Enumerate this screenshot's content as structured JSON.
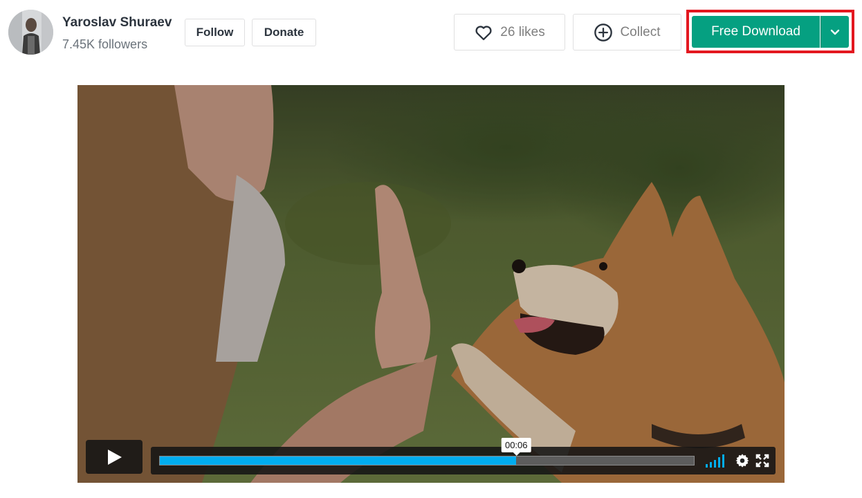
{
  "author": {
    "name": "Yaroslav Shuraev",
    "followers": "7.45K followers"
  },
  "actions": {
    "follow_label": "Follow",
    "donate_label": "Donate",
    "likes_label": "26 likes",
    "collect_label": "Collect",
    "download_label": "Free Download"
  },
  "icons": {
    "like": "heart-icon",
    "collect": "plus-circle-icon",
    "download_toggle": "chevron-down-icon",
    "play": "play-icon",
    "volume": "volume-icon",
    "settings": "gear-icon",
    "fullscreen": "fullscreen-icon"
  },
  "colors": {
    "download_button": "#05a081",
    "highlight_frame": "#e3171f",
    "progress": "#00adef"
  },
  "player": {
    "current_time": "00:06",
    "progress_fraction": 0.667
  }
}
